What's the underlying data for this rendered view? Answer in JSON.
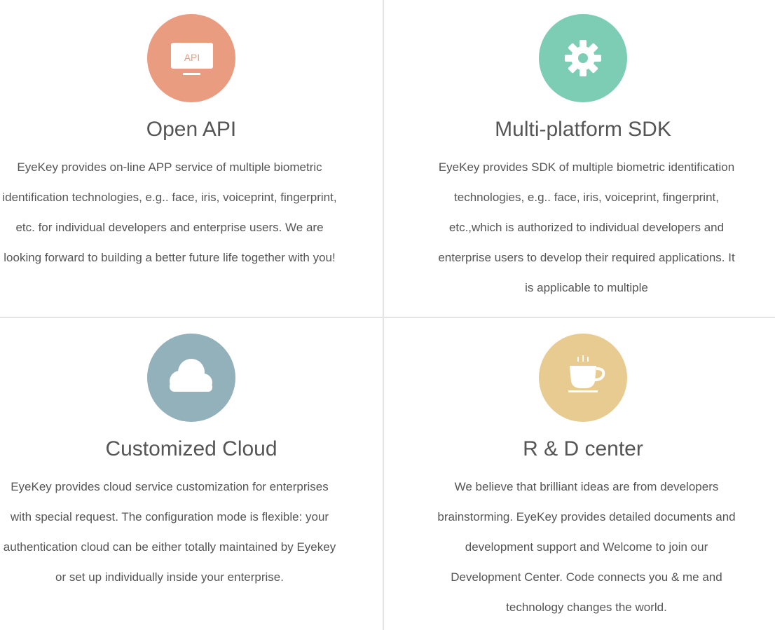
{
  "features": [
    {
      "title": "Open API",
      "icon": "api-monitor-icon",
      "icon_label": "API",
      "color": "#EA9C80",
      "description": "EyeKey provides on-line APP service of multiple biometric identification technologies, e.g.. face, iris, voiceprint, fingerprint, etc. for individual developers and enterprise users. We are looking forward to building a better future life together with you!"
    },
    {
      "title": "Multi-platform SDK",
      "icon": "gear-icon",
      "color": "#7DCDB5",
      "description": "EyeKey provides SDK of multiple biometric identification technologies, e.g.. face, iris, voiceprint, fingerprint, etc.,which is authorized to individual developers and enterprise users to develop their required applications. It is applicable to multiple"
    },
    {
      "title": "Customized Cloud",
      "icon": "cloud-icon",
      "color": "#93B1BA",
      "description": "EyeKey provides cloud service customization for enterprises with special request. The configuration mode is flexible: your authentication cloud can be either totally maintained by Eyekey or set up individually inside your enterprise."
    },
    {
      "title": "R & D center",
      "icon": "coffee-cup-icon",
      "color": "#E8CB90",
      "description": "We believe that brilliant ideas are from developers brainstorming. EyeKey provides detailed documents and development support and Welcome to join our Development Center. Code connects you & me and technology changes the world."
    }
  ]
}
